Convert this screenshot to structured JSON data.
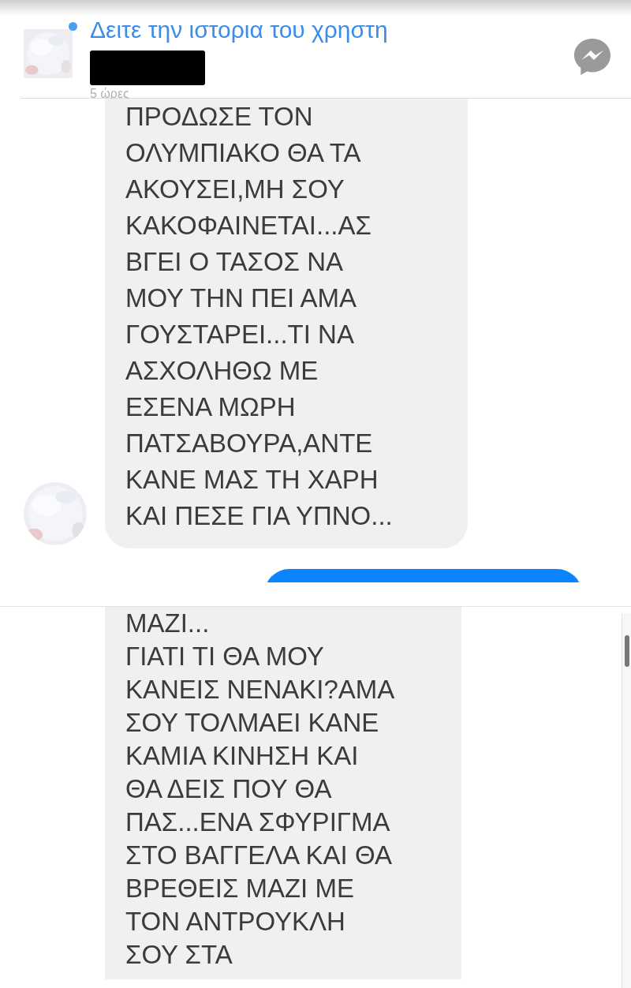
{
  "panels": [
    {
      "header": {
        "online": true,
        "story_link": "Δειτε την ιστορια του χρηστη",
        "sender_name": {
          "redacted": true
        },
        "timestamp": "5 ώρες"
      },
      "messages": [
        {
          "kind": "received",
          "avatar": true,
          "text": "ΠΡΟΔΩΣΕ ΤΟΝ\nΟΛΥΜΠΙΑΚΟ ΘΑ ΤΑ\nΑΚΟΥΣΕΙ,ΜΗ ΣΟΥ\nΚΑΚΟΦΑΙΝΕΤΑΙ...ΑΣ\nΒΓΕΙ Ο ΤΑΣΟΣ ΝΑ\nΜΟΥ ΤΗΝ ΠΕΙ ΑΜΑ\nΓΟΥΣΤΑΡΕΙ...ΤΙ ΝΑ\nΑΣΧΟΛΗΘΩ ΜΕ\nΕΣΕΝΑ ΜΩΡΗ\nΠΑΤΣΑΒΟΥΡΑ,ΑΝΤΕ\nΚΑΝΕ ΜΑΣ ΤΗ ΧΑΡΗ\nΚΑΙ ΠΕΣΕ ΓΙΑ ΥΠΝΟ..."
        },
        {
          "kind": "sent"
        }
      ]
    },
    {
      "messages": [
        {
          "kind": "received",
          "avatar": false,
          "text": "ΜΑΖΙ...\nΓΙΑΤΙ ΤΙ ΘΑ ΜΟΥ\nΚΑΝΕΙΣ ΝΕΝΑΚΙ?ΑΜΑ\nΣΟΥ ΤΟΛΜΑΕΙ ΚΑΝΕ\nΚΑΜΙΑ ΚΙΝΗΣΗ ΚΑΙ\nΘΑ ΔΕΙΣ ΠΟΥ ΘΑ\nΠΑΣ...ΕΝΑ ΣΦΥΡΙΓΜΑ\nΣΤΟ ΒΑΓΓΕΛΑ ΚΑΙ ΘΑ\nΒΡΕΘΕΙΣ ΜΑΖΙ ΜΕ\nΤΟΝ ΑΝΤΡΟΥΚΛΗ\nΣΟΥ ΣΤΑ"
        }
      ]
    }
  ]
}
